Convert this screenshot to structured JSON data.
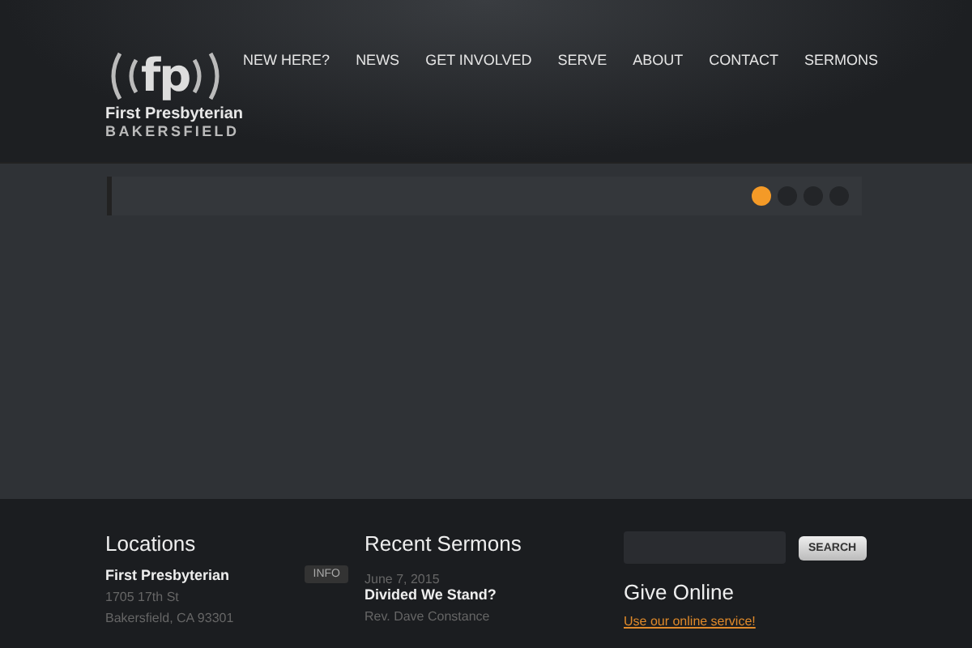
{
  "logo": {
    "mark": "fp",
    "name": "First Presbyterian",
    "city": "BAKERSFIELD"
  },
  "nav": [
    {
      "label": "NEW HERE?"
    },
    {
      "label": "NEWS"
    },
    {
      "label": "GET INVOLVED"
    },
    {
      "label": "SERVE"
    },
    {
      "label": "ABOUT"
    },
    {
      "label": "CONTACT"
    },
    {
      "label": "SERMONS"
    }
  ],
  "slider": {
    "dots": [
      {
        "selected": true
      },
      {
        "selected": false
      },
      {
        "selected": false
      },
      {
        "selected": false
      }
    ]
  },
  "locations": {
    "title": "Locations",
    "name": "First Presbyterian",
    "button": "INFO",
    "lines": [
      "1705 17th St",
      "Bakersfield, CA 93301"
    ]
  },
  "sermons": {
    "title": "Recent Sermons",
    "date": "June 7, 2015",
    "sermon_title": "Divided We Stand?",
    "speaker": "Rev. Dave Constance"
  },
  "search": {
    "button": "SEARCH"
  },
  "give": {
    "title": "Give Online",
    "link": "Use our online service!"
  }
}
